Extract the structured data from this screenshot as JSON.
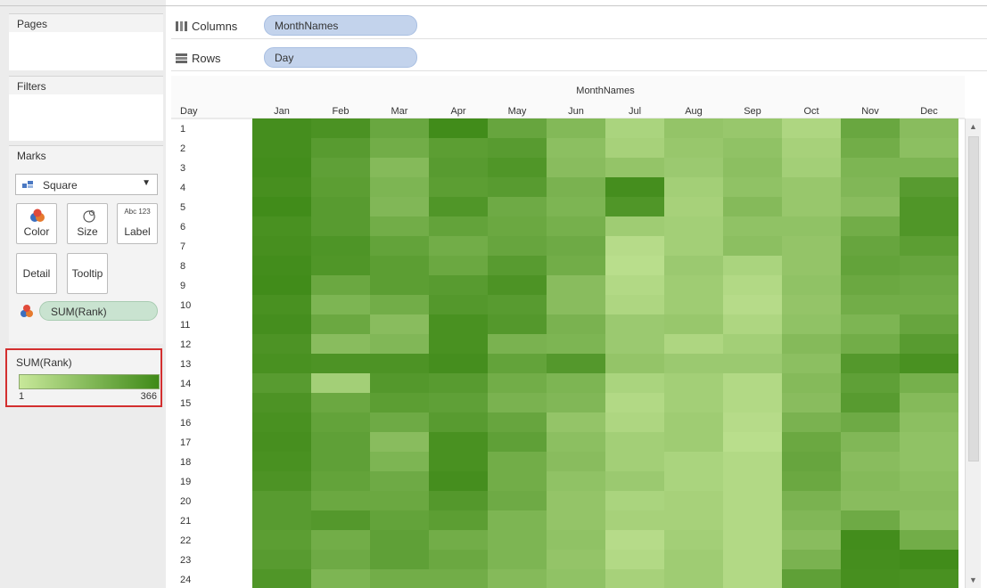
{
  "shelves": {
    "pages": "Pages",
    "filters": "Filters",
    "columns": {
      "label": "Columns",
      "pill": "MonthNames"
    },
    "rows": {
      "label": "Rows",
      "pill": "Day"
    }
  },
  "marks": {
    "title": "Marks",
    "mark_type": "Square",
    "buttons": {
      "color": "Color",
      "size": "Size",
      "label": "Label",
      "label_glyph": "Abc 123",
      "detail": "Detail",
      "tooltip": "Tooltip"
    },
    "color_pill": "SUM(Rank)"
  },
  "legend": {
    "title": "SUM(Rank)",
    "min": "1",
    "max": "366",
    "color_low": "#c8e89a",
    "color_high": "#3f8a18"
  },
  "chart_data": {
    "type": "heatmap",
    "title": "MonthNames",
    "row_header": "Day",
    "x_categories": [
      "Jan",
      "Feb",
      "Mar",
      "Apr",
      "May",
      "Jun",
      "Jul",
      "Aug",
      "Sep",
      "Oct",
      "Nov",
      "Dec"
    ],
    "y_categories": [
      "1",
      "2",
      "3",
      "4",
      "5",
      "6",
      "7",
      "8",
      "9",
      "10",
      "11",
      "12",
      "13",
      "14",
      "15",
      "16",
      "17",
      "18",
      "19",
      "20",
      "21",
      "22",
      "23",
      "24"
    ],
    "color_range": [
      1,
      366
    ],
    "values": [
      [
        350,
        335,
        255,
        360,
        260,
        185,
        80,
        140,
        130,
        70,
        255,
        170
      ],
      [
        350,
        300,
        230,
        290,
        300,
        160,
        90,
        130,
        150,
        90,
        230,
        160
      ],
      [
        355,
        280,
        180,
        300,
        320,
        170,
        140,
        120,
        160,
        100,
        200,
        200
      ],
      [
        345,
        290,
        200,
        290,
        300,
        210,
        350,
        100,
        150,
        130,
        190,
        300
      ],
      [
        360,
        300,
        190,
        320,
        240,
        200,
        320,
        90,
        180,
        130,
        170,
        320
      ],
      [
        340,
        300,
        230,
        270,
        250,
        220,
        110,
        100,
        150,
        150,
        230,
        320
      ],
      [
        345,
        325,
        270,
        230,
        260,
        240,
        50,
        100,
        160,
        140,
        260,
        290
      ],
      [
        355,
        320,
        290,
        250,
        300,
        230,
        40,
        120,
        80,
        140,
        270,
        260
      ],
      [
        360,
        250,
        290,
        300,
        330,
        170,
        60,
        110,
        60,
        150,
        250,
        240
      ],
      [
        340,
        200,
        230,
        310,
        300,
        170,
        70,
        110,
        50,
        140,
        230,
        230
      ],
      [
        350,
        250,
        170,
        340,
        310,
        210,
        120,
        130,
        70,
        150,
        200,
        260
      ],
      [
        330,
        170,
        190,
        340,
        210,
        200,
        120,
        70,
        100,
        180,
        230,
        300
      ],
      [
        340,
        330,
        330,
        350,
        270,
        310,
        140,
        120,
        120,
        160,
        310,
        340
      ],
      [
        300,
        100,
        310,
        300,
        230,
        200,
        80,
        100,
        60,
        180,
        280,
        220
      ],
      [
        330,
        250,
        290,
        280,
        210,
        190,
        60,
        100,
        60,
        170,
        300,
        180
      ],
      [
        340,
        270,
        240,
        300,
        260,
        140,
        70,
        110,
        50,
        210,
        240,
        160
      ],
      [
        345,
        280,
        170,
        340,
        280,
        160,
        100,
        110,
        40,
        250,
        190,
        150
      ],
      [
        340,
        280,
        200,
        340,
        230,
        170,
        100,
        80,
        60,
        260,
        170,
        150
      ],
      [
        330,
        270,
        240,
        350,
        230,
        150,
        120,
        80,
        60,
        250,
        180,
        160
      ],
      [
        300,
        250,
        250,
        310,
        240,
        140,
        80,
        90,
        60,
        210,
        170,
        170
      ],
      [
        300,
        310,
        270,
        290,
        200,
        140,
        90,
        90,
        60,
        190,
        240,
        160
      ],
      [
        290,
        230,
        280,
        230,
        200,
        150,
        50,
        100,
        60,
        170,
        355,
        230
      ],
      [
        300,
        240,
        280,
        250,
        200,
        140,
        60,
        110,
        60,
        210,
        350,
        360
      ],
      [
        320,
        200,
        230,
        230,
        180,
        150,
        90,
        110,
        60,
        280,
        345,
        340
      ]
    ]
  }
}
